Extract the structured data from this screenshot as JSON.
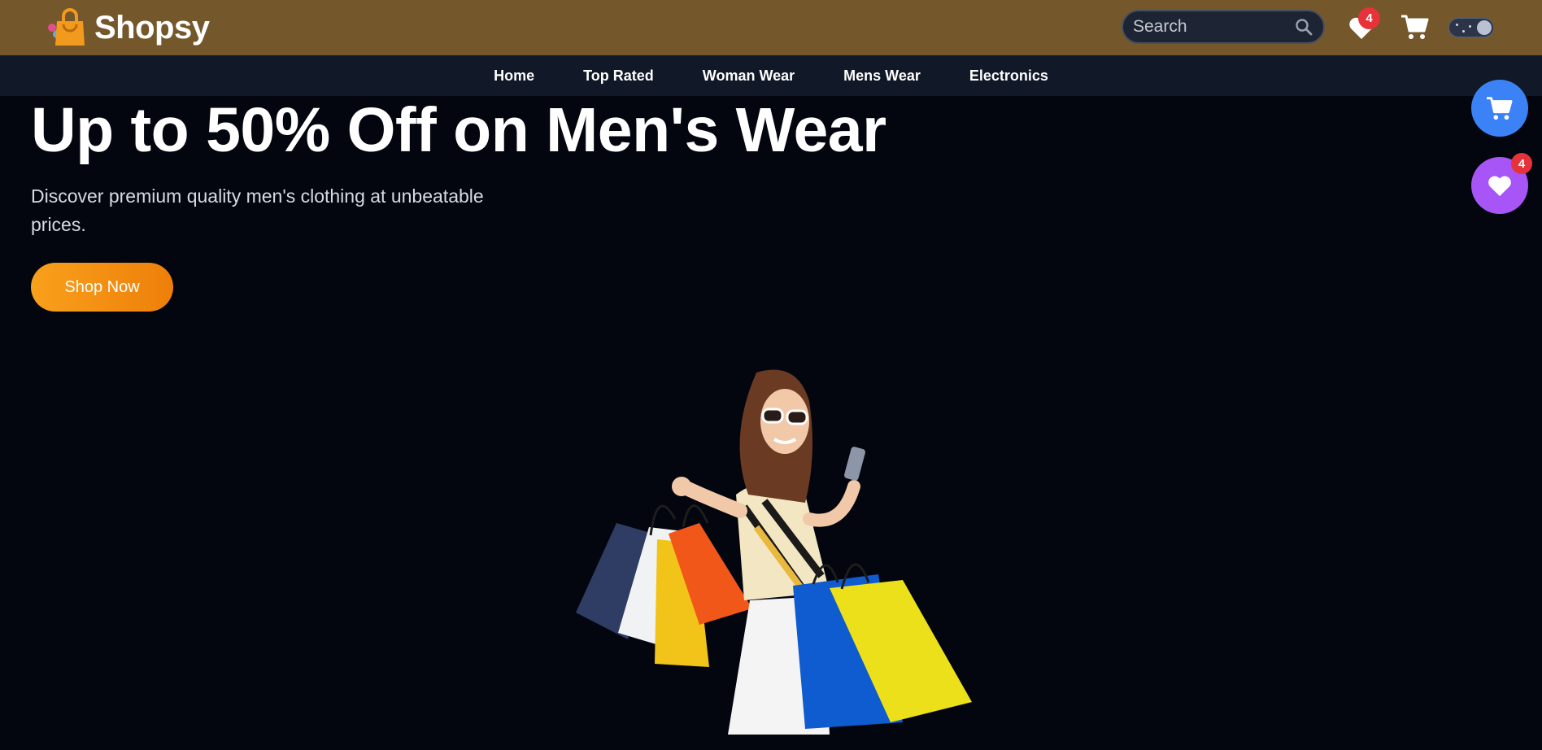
{
  "brand": {
    "name": "Shopsy",
    "logo_icon": "shopping-bag-icon"
  },
  "header": {
    "search": {
      "placeholder": "Search",
      "value": ""
    },
    "wishlist_count": "4",
    "icons": [
      "search-icon",
      "heart-icon",
      "cart-icon",
      "theme-toggle"
    ]
  },
  "nav": {
    "items": [
      {
        "label": "Home"
      },
      {
        "label": "Top Rated"
      },
      {
        "label": "Woman Wear"
      },
      {
        "label": "Mens Wear"
      },
      {
        "label": "Electronics"
      }
    ]
  },
  "hero": {
    "title": "Up to 50% Off on Men's Wear",
    "subtitle": "Discover premium quality men's clothing at unbeatable prices.",
    "cta_label": "Shop Now",
    "image": "woman-with-shopping-bags"
  },
  "floating": {
    "cart_icon": "cart-icon",
    "wishlist_icon": "heart-icon",
    "wishlist_count": "4"
  },
  "colors": {
    "topbar": "#74572a",
    "navbar": "#111827",
    "background": "#03060f",
    "cta_start": "#f9a01c",
    "cta_end": "#ee7f09",
    "float_cart": "#3b82f6",
    "float_wish": "#a855f7",
    "badge": "#e8323a"
  }
}
